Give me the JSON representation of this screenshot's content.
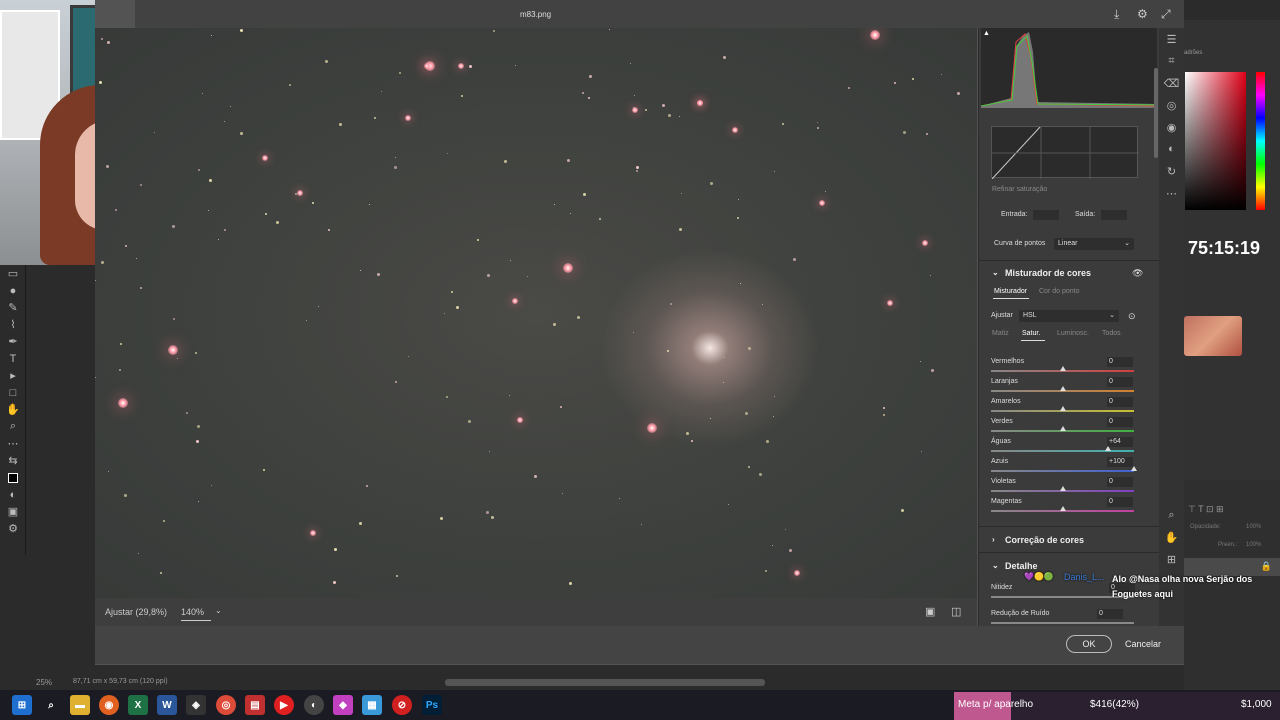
{
  "dialog": {
    "file_title": "m83.png",
    "fit_label": "Ajustar (29,8%)",
    "zoom_label": "140%",
    "ok_label": "OK",
    "cancel_label": "Cancelar"
  },
  "panel": {
    "refine_saturation": "Refinar saturação",
    "input_label": "Entrada:",
    "output_label": "Saída:",
    "point_curve_label": "Curva de pontos",
    "point_curve_value": "Linear",
    "color_mixer_title": "Misturador de cores",
    "mixer_tabs": [
      "Misturador",
      "Cor do ponto"
    ],
    "adjust_label": "Ajustar",
    "adjust_value": "HSL",
    "hsl_tabs": [
      "Matiz",
      "Satur.",
      "Luminosc.",
      "Todos"
    ],
    "sliders": [
      {
        "label": "Vermelhos",
        "value": "0",
        "pos": 0.5,
        "color": "#d04040"
      },
      {
        "label": "Laranjas",
        "value": "0",
        "pos": 0.5,
        "color": "#d08030"
      },
      {
        "label": "Amarelos",
        "value": "0",
        "pos": 0.5,
        "color": "#c8c030"
      },
      {
        "label": "Verdes",
        "value": "0",
        "pos": 0.5,
        "color": "#40b040"
      },
      {
        "label": "Águas",
        "value": "+64",
        "pos": 0.82,
        "color": "#40b0b0"
      },
      {
        "label": "Azuis",
        "value": "+100",
        "pos": 1.0,
        "color": "#4060d0"
      },
      {
        "label": "Violetas",
        "value": "0",
        "pos": 0.5,
        "color": "#8040c0"
      },
      {
        "label": "Magentas",
        "value": "0",
        "pos": 0.5,
        "color": "#c040a0"
      }
    ],
    "color_correction_title": "Correção de cores",
    "detail_title": "Detalhe",
    "sharpness_label": "Nitidez",
    "sharpness_value": "0",
    "noise_label": "Redução de Ruído",
    "noise_value": "0"
  },
  "overlay": {
    "timer": "75:15:19",
    "chat_user": "Danis_L...",
    "chat_message": "Alo @Nasa olha nova Serjão dos Foguetes aqui"
  },
  "ps": {
    "status_zoom": "25%",
    "status_size": "87,71 cm x 59,73 cm (120 ppi)",
    "right_panel_label": "adrões",
    "opacity_label": "Opacidade:",
    "opacity_value": "100%",
    "fill_label": "Preen.:",
    "fill_value": "100%"
  },
  "taskbar": {
    "goal_label": "Meta p/ aparelho",
    "goal_progress_text": "$416(42%)",
    "goal_progress": 0.42,
    "goal_target": "$1,000"
  }
}
